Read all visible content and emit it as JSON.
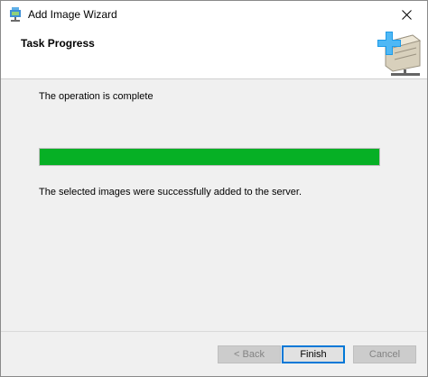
{
  "window": {
    "title": "Add Image Wizard",
    "title_icon": "image-server-icon",
    "close_icon": "close-icon"
  },
  "header": {
    "title": "Task Progress",
    "graphic_icon": "add-image-server-icon"
  },
  "main": {
    "status_text": "The operation is complete",
    "progress": {
      "percent": 100,
      "color": "#06b025"
    },
    "result_text": "The selected images were successfully added to the server."
  },
  "footer": {
    "back_label": "< Back",
    "finish_label": "Finish",
    "cancel_label": "Cancel"
  },
  "colors": {
    "accent": "#0078d7",
    "progress_green": "#06b025"
  }
}
